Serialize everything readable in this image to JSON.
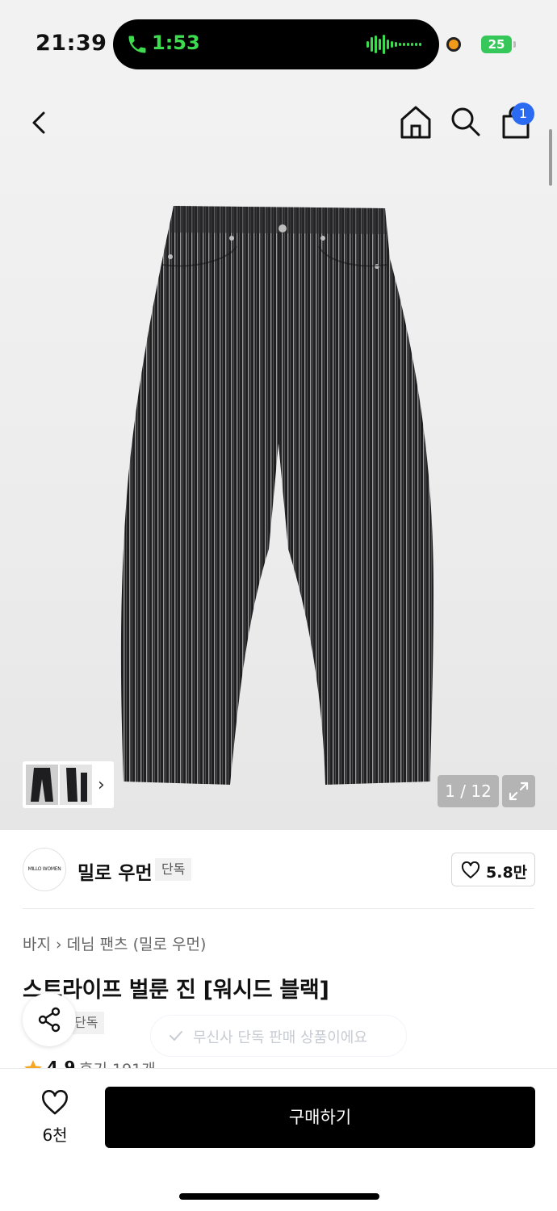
{
  "status_bar": {
    "time": "21:39",
    "call_duration": "1:53",
    "battery": "25",
    "call_color": "#3ddc4f"
  },
  "nav": {
    "cart_count": "1"
  },
  "gallery": {
    "counter": "1 / 12"
  },
  "brand": {
    "logo_text": "MILLO WOMEN",
    "name": "밀로 우먼",
    "tag": "단독",
    "likes": "5.8만"
  },
  "product": {
    "breadcrumb": [
      "바지",
      "데님 팬츠 (밀로 우먼)"
    ],
    "title": "스트라이프 벌룬 진 [워시드 블랙]",
    "exclusive_tag": "단독",
    "toast": "무신사 단독 판매 상품이에요",
    "rating": "4.9",
    "reviews": "후기 191개"
  },
  "bottom_bar": {
    "wish_count": "6천",
    "buy_label": "구매하기"
  },
  "colors": {
    "accent_blue": "#2a6bf2",
    "star": "#f5a623",
    "buy_button": "#000000"
  }
}
